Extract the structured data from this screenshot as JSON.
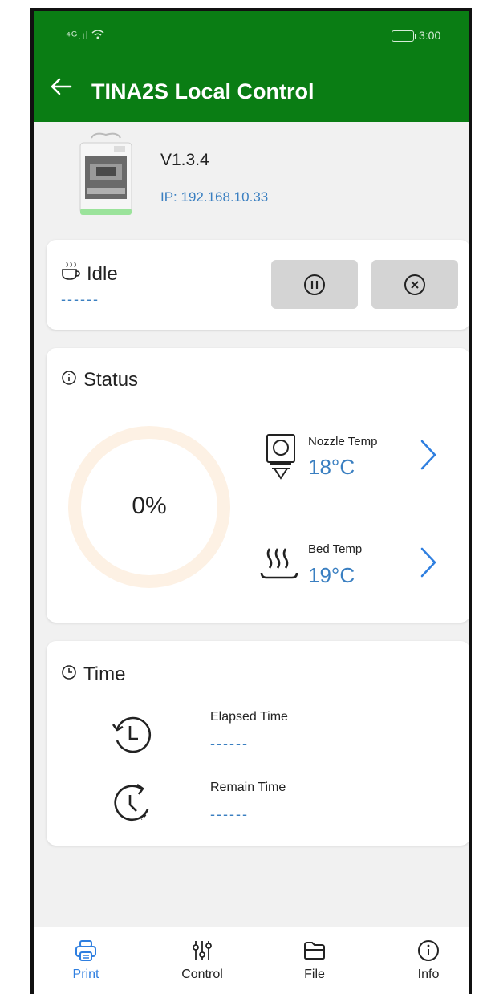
{
  "status_bar": {
    "signal": "⁴ᴳ.ıl",
    "time": "3:00"
  },
  "header": {
    "back_icon": "arrow-left-icon",
    "title": "TINA2S Local Control"
  },
  "device": {
    "version": "V1.3.4",
    "ip": "IP: 192.168.10.33"
  },
  "job": {
    "icon": "idle-cup-icon",
    "state": "Idle",
    "name": "------",
    "pause_icon": "pause-icon",
    "cancel_icon": "cancel-icon"
  },
  "status": {
    "title": "Status",
    "progress_text": "0%",
    "progress": 0,
    "nozzle": {
      "label": "Nozzle Temp",
      "value": "18°C"
    },
    "bed": {
      "label": "Bed Temp",
      "value": "19°C"
    }
  },
  "time": {
    "title": "Time",
    "elapsed": {
      "label": "Elapsed Time",
      "value": "------"
    },
    "remain": {
      "label": "Remain Time",
      "value": "------"
    }
  },
  "nav": [
    {
      "label": "Print",
      "icon": "printer-icon",
      "active": true
    },
    {
      "label": "Control",
      "icon": "sliders-icon",
      "active": false
    },
    {
      "label": "File",
      "icon": "folder-icon",
      "active": false
    },
    {
      "label": "Info",
      "icon": "info-icon",
      "active": false
    }
  ],
  "colors": {
    "header": "#0a7d14",
    "accent": "#3a7fc1",
    "nav_active": "#2f7fe0",
    "ring": "#fdf1e4"
  }
}
